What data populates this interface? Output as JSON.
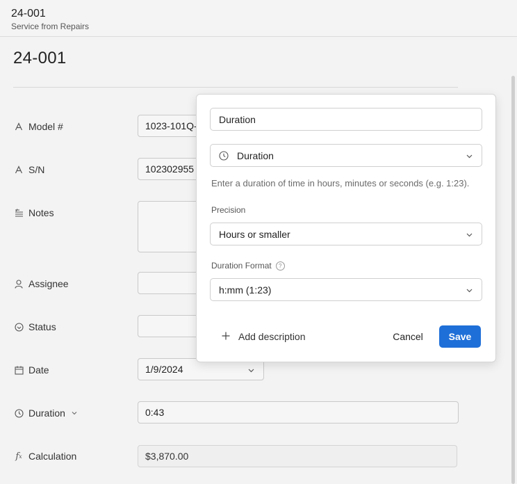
{
  "header": {
    "title": "24-001",
    "subtitle": "Service from Repairs"
  },
  "record": {
    "title": "24-001"
  },
  "fields": {
    "model": {
      "label": "Model #",
      "value": "1023-101Q-"
    },
    "sn": {
      "label": "S/N",
      "value": "102302955"
    },
    "notes": {
      "label": "Notes",
      "value": ""
    },
    "assignee": {
      "label": "Assignee",
      "value": ""
    },
    "status": {
      "label": "Status",
      "value": ""
    },
    "date": {
      "label": "Date",
      "value": "1/9/2024"
    },
    "duration": {
      "label": "Duration",
      "value": "0:43"
    },
    "calculation": {
      "label": "Calculation",
      "value": "$3,870.00"
    }
  },
  "popover": {
    "name_value": "Duration",
    "type_value": "Duration",
    "hint": "Enter a duration of time in hours, minutes or seconds (e.g. 1:23).",
    "precision_label": "Precision",
    "precision_value": "Hours or smaller",
    "format_label": "Duration Format",
    "format_help": "?",
    "format_value": "h:mm (1:23)",
    "add_description": "Add description",
    "cancel": "Cancel",
    "save": "Save"
  },
  "colors": {
    "accent": "#1f6fd8",
    "background": "#f3f3f3"
  },
  "icons": {
    "model": "text-a-icon",
    "sn": "text-a-icon",
    "notes": "long-text-icon",
    "assignee": "person-icon",
    "status": "status-check-circle-icon",
    "date": "calendar-icon",
    "duration": "clock-icon",
    "calculation": "fx-formula-icon"
  }
}
